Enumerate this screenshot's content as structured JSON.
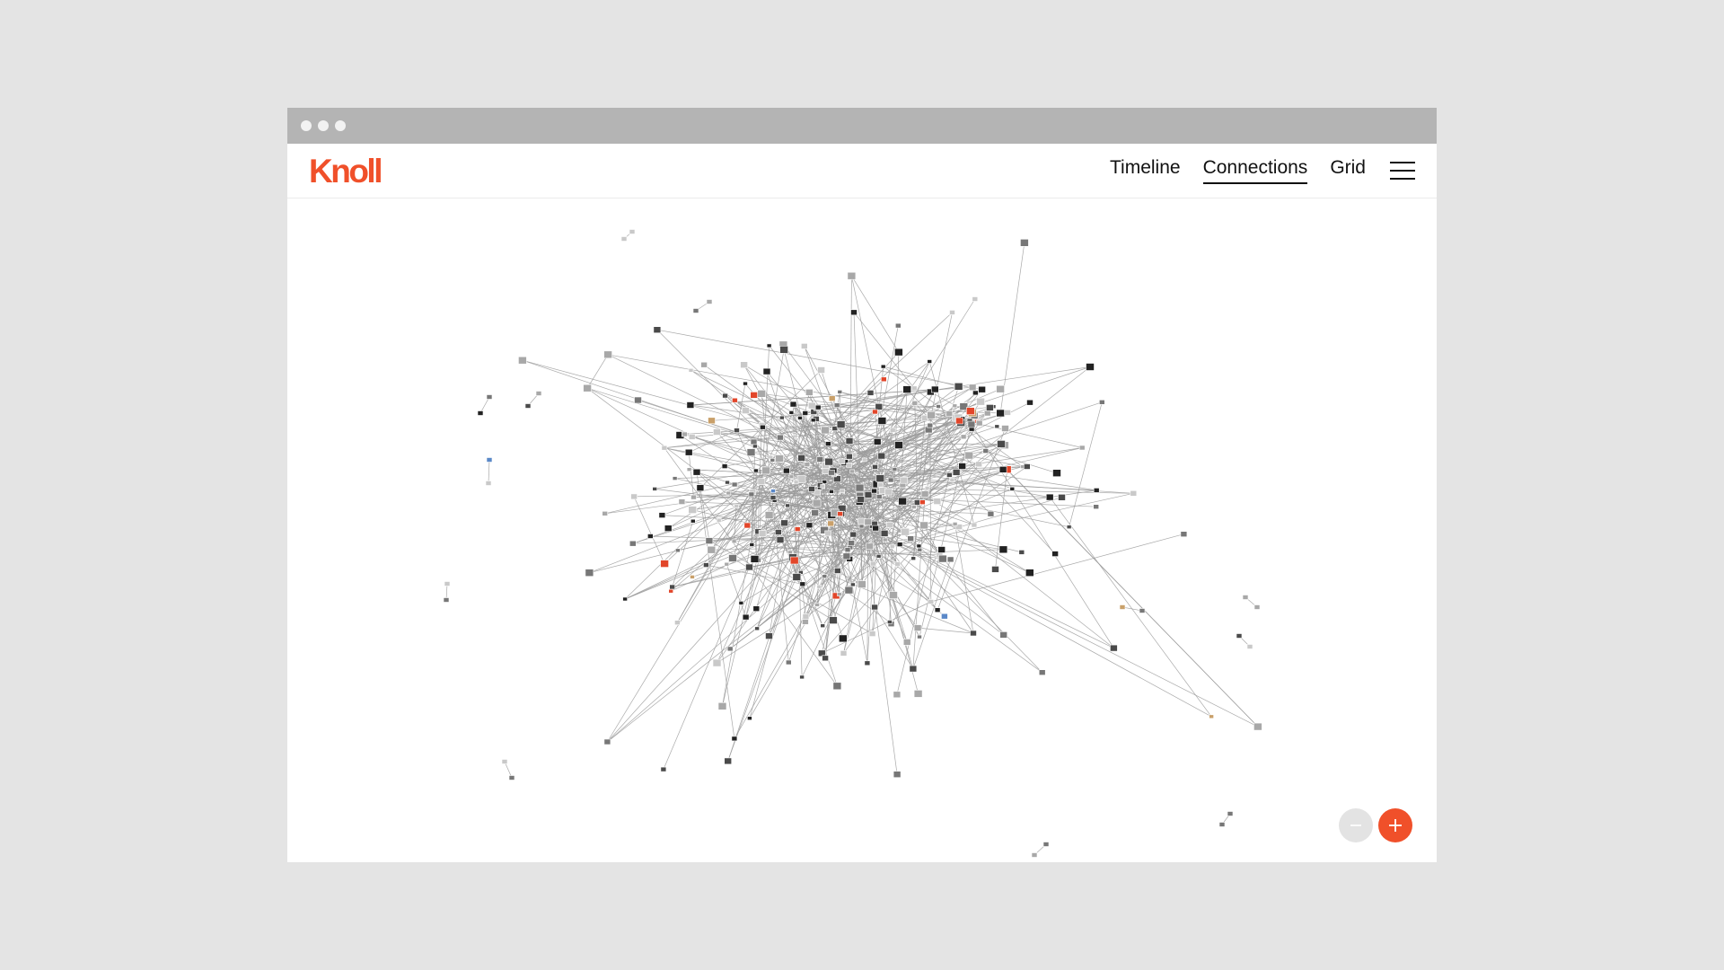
{
  "app": {
    "logo_text": "Knoll"
  },
  "nav": {
    "items": [
      {
        "label": "Timeline",
        "active": false
      },
      {
        "label": "Connections",
        "active": true
      },
      {
        "label": "Grid",
        "active": false
      }
    ],
    "menu_icon": "hamburger-menu-icon"
  },
  "graph": {
    "view": "connections-network",
    "link_color": "#9a9a9a",
    "node_palette": [
      "#222222",
      "#4a4a4a",
      "#777777",
      "#a8a8a8",
      "#c9c9c9",
      "#e2462a",
      "#c9a06a",
      "#5a88c8"
    ]
  },
  "controls": {
    "zoom_out_icon": "minus-icon",
    "zoom_in_icon": "plus-icon"
  },
  "colors": {
    "brand": "#f0502a",
    "page_background": "#e4e4e4",
    "titlebar": "#b4b4b4"
  }
}
